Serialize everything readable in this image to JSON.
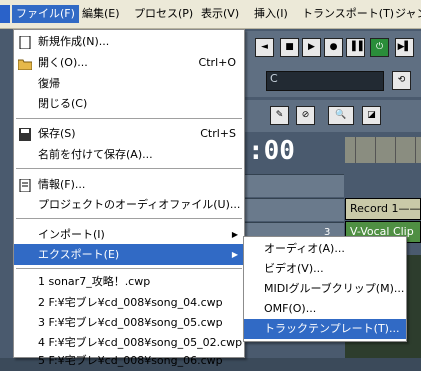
{
  "menubar": {
    "items": [
      "ファイル(F)",
      "編集(E)",
      "プロセス(P)",
      "表示(V)",
      "挿入(I)",
      "トランスポート(T)",
      "ジャン"
    ]
  },
  "daw": {
    "time_display": ":00",
    "key_field": "C",
    "clips": [
      "Record 1——",
      "V-Vocal Clip"
    ],
    "track_numbers": [
      "",
      "",
      "3"
    ]
  },
  "file_menu": {
    "new": "新規作成(N)...",
    "open": "開く(O)...",
    "open_shortcut": "Ctrl+O",
    "revert": "復帰",
    "close": "閉じる(C)",
    "save": "保存(S)",
    "save_shortcut": "Ctrl+S",
    "save_as": "名前を付けて保存(A)...",
    "info": "情報(F)...",
    "project_audio": "プロジェクトのオーディオファイル(U)...",
    "import": "インポート(I)",
    "export": "エクスポート(E)",
    "recent": [
      "1 sonar7_攻略！.cwp",
      "2 F:¥宅ブレ¥cd_008¥song_04.cwp",
      "3 F:¥宅ブレ¥cd_008¥song_05.cwp",
      "4 F:¥宅ブレ¥cd_008¥song_05_02.cwp",
      "5 F:¥宅ブレ¥cd_008¥song_06.cwp"
    ]
  },
  "export_submenu": {
    "audio": "オーディオ(A)...",
    "video": "ビデオ(V)...",
    "midi_groove": "MIDIグルーブクリップ(M)...",
    "omf": "OMF(O)...",
    "track_template": "トラックテンプレート(T)..."
  },
  "colors": {
    "highlight": "#316ac5",
    "menu_bg": "#ffffff",
    "menubar_bg": "#ece9d8"
  }
}
